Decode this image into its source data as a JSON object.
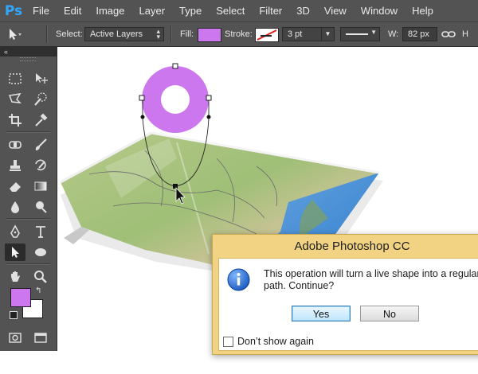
{
  "app": {
    "logo": "Ps",
    "dialog_title": "Adobe Photoshop CC"
  },
  "menu": [
    "File",
    "Edit",
    "Image",
    "Layer",
    "Type",
    "Select",
    "Filter",
    "3D",
    "View",
    "Window",
    "Help"
  ],
  "options": {
    "select_label": "Select:",
    "select_value": "Active Layers",
    "fill_label": "Fill:",
    "fill_color": "#cc77ee",
    "stroke_label": "Stroke:",
    "stroke_width": "3 pt",
    "width_label": "W:",
    "width_value": "82 px"
  },
  "toolbar": {
    "collapse": "«",
    "foreground_color": "#cc77ee",
    "background_color": "#ffffff"
  },
  "dialog": {
    "message": "This operation will turn a live shape into a regular\npath. Continue?",
    "yes": "Yes",
    "no": "No",
    "checkbox": "Don’t show again"
  },
  "shape": {
    "color": "#cc77ee"
  }
}
